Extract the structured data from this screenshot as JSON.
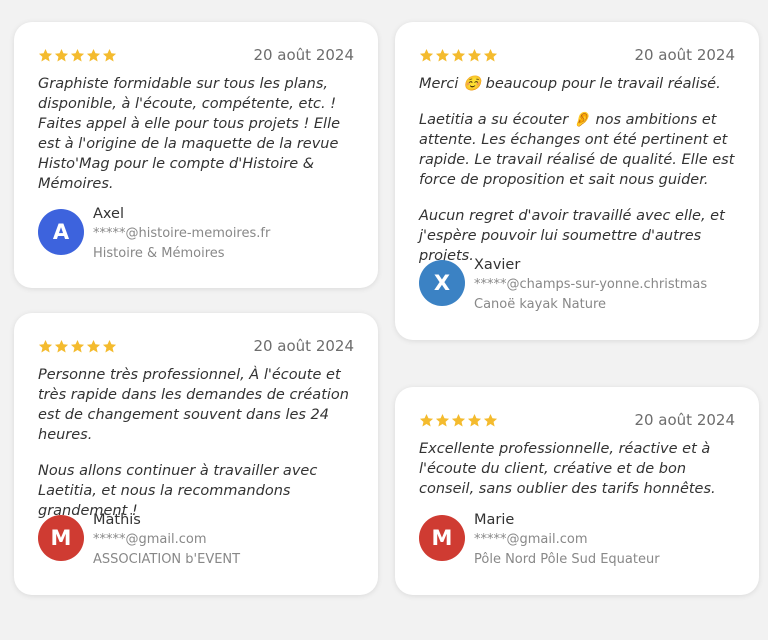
{
  "colors": {
    "star": "#f4bb2e",
    "background": "#f2f2f2",
    "card": "#ffffff"
  },
  "reviews": [
    {
      "rating": 5,
      "date": "20 août 2024",
      "paragraphs": [
        "Graphiste formidable sur tous les plans, disponible, à l'écoute, compétente, etc. ! Faites appel à elle pour tous projets ! Elle est à l'origine de la maquette de la revue Histo'Mag pour le compte d'Histoire & Mémoires."
      ],
      "author": {
        "initial": "A",
        "name": "Axel",
        "email": "*****@histoire-memoires.fr",
        "company": "Histoire & Mémoires",
        "avatar_color": "#3d63dd"
      }
    },
    {
      "rating": 5,
      "date": "20 août 2024",
      "paragraphs": [
        "Merci ☺️ beaucoup pour le travail réalisé.",
        "Laetitia a su écouter 👂 nos ambitions et attente. Les échanges ont été pertinent et rapide. Le travail réalisé de qualité. Elle est force de proposition et sait nous guider.",
        "Aucun regret d'avoir travaillé avec elle, et j'espère pouvoir lui soumettre d'autres projets."
      ],
      "author": {
        "initial": "X",
        "name": "Xavier",
        "email": "*****@champs-sur-yonne.christmas",
        "company": "Canoë kayak Nature",
        "avatar_color": "#3b82c4"
      }
    },
    {
      "rating": 5,
      "date": "20 août 2024",
      "paragraphs": [
        "Personne très professionnel, À l'écoute et très rapide dans les demandes de création est de changement souvent dans les 24 heures.",
        "Nous allons continuer à travailler avec Laetitia, et nous la recommandons grandement !"
      ],
      "author": {
        "initial": "M",
        "name": "Mathis",
        "email": "*****@gmail.com",
        "company": "ASSOCIATION b'EVENT",
        "avatar_color": "#cf3b32"
      }
    },
    {
      "rating": 5,
      "date": "20 août 2024",
      "paragraphs": [
        "Excellente professionnelle, réactive et à l'écoute du client, créative et de bon conseil, sans oublier des tarifs honnêtes."
      ],
      "author": {
        "initial": "M",
        "name": "Marie",
        "email": "*****@gmail.com",
        "company": "Pôle Nord Pôle Sud Equateur",
        "avatar_color": "#cf3b32"
      }
    }
  ]
}
